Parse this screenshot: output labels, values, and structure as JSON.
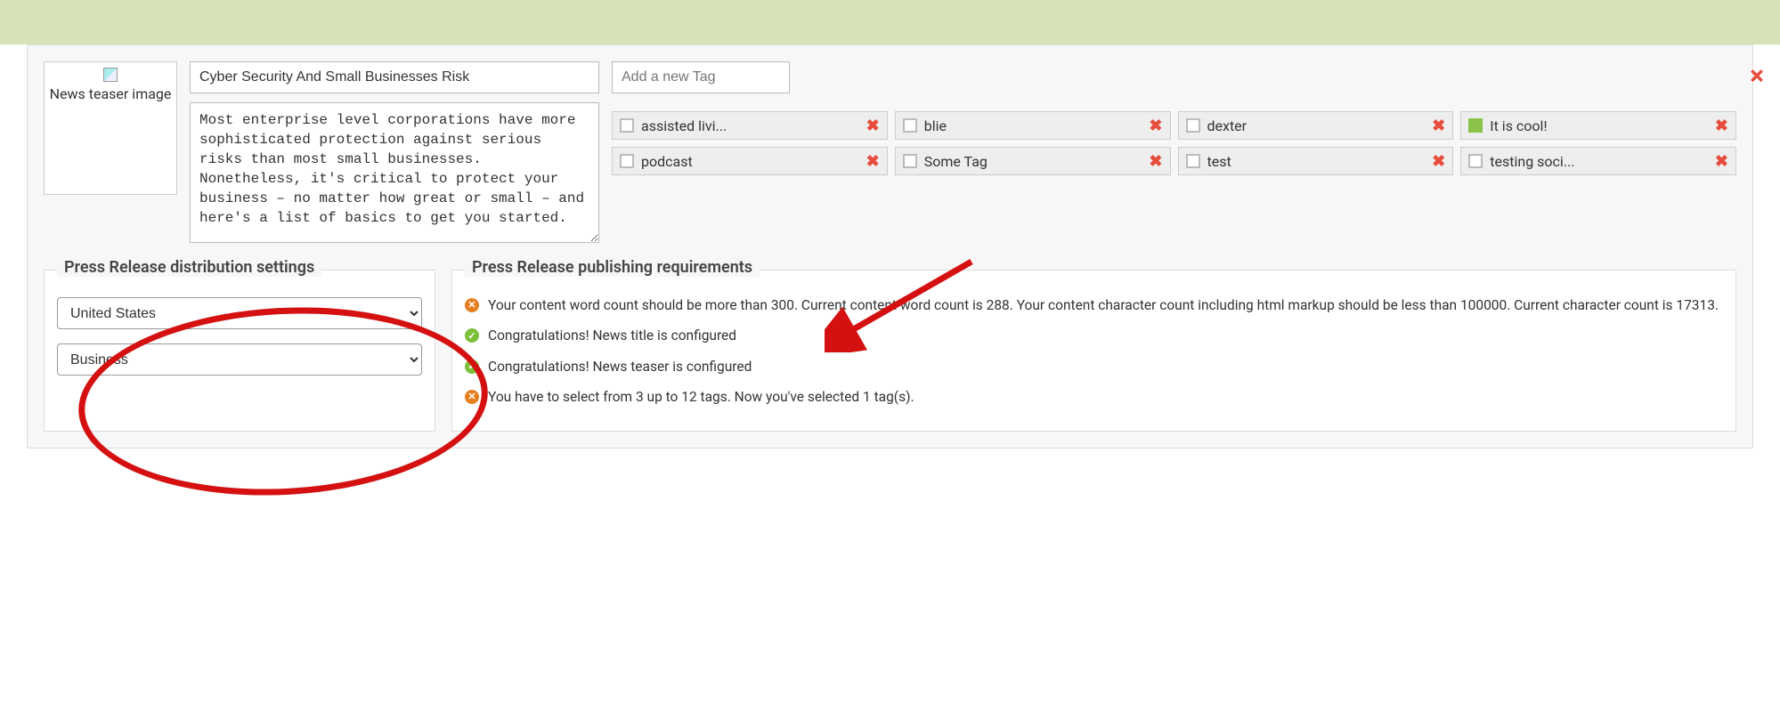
{
  "modal": {
    "close_icon": "×"
  },
  "teaser_image_alt": "News teaser image",
  "title_value": "Cyber Security And Small Businesses Risk",
  "teaser_value": "Most enterprise level corporations have more sophisticated protection against serious risks than most small businesses. Nonetheless, it's critical to protect your business – no matter how great or small – and here's a list of basics to get you started.",
  "tag_input_placeholder": "Add a new Tag",
  "tags": [
    {
      "label": "assisted livi...",
      "checked": false
    },
    {
      "label": "blie",
      "checked": false
    },
    {
      "label": "dexter",
      "checked": false
    },
    {
      "label": "It is cool!",
      "checked": true
    },
    {
      "label": "podcast",
      "checked": false
    },
    {
      "label": "Some Tag",
      "checked": false
    },
    {
      "label": "test",
      "checked": false
    },
    {
      "label": "testing soci...",
      "checked": false
    }
  ],
  "distribution": {
    "legend": "Press Release distribution settings",
    "country": "United States",
    "category": "Business"
  },
  "requirements": {
    "legend": "Press Release publishing requirements",
    "items": [
      {
        "status": "error",
        "text": "Your content word count should be more than 300. Current content word count is 288. Your content character count including html markup should be less than 100000. Current character count is 17313."
      },
      {
        "status": "ok",
        "text": "Congratulations! News title is configured"
      },
      {
        "status": "ok",
        "text": "Congratulations! News teaser is configured"
      },
      {
        "status": "error",
        "text": "You have to select from 3 up to 12 tags. Now you've selected 1 tag(s)."
      }
    ]
  }
}
